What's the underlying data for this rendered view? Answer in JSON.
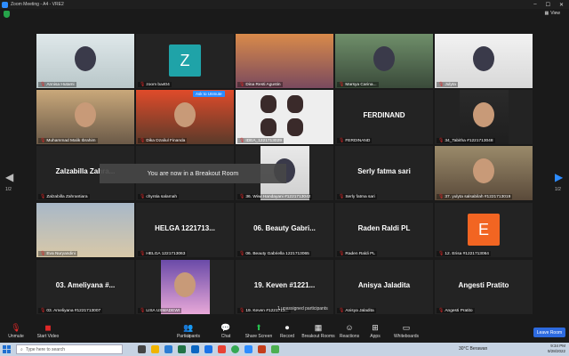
{
  "window": {
    "title": "Zoom Meeting - A4 - VRE2"
  },
  "view_label": "View",
  "nav": {
    "left_page": "1/2",
    "right_page": "1/2"
  },
  "banner": "You are now in a Breakout Room",
  "ask_unmute": "Ask to Unmute",
  "unassigned": "1 unassigned participants",
  "tiles": [
    {
      "caption": "Annisa Hutami",
      "big": ""
    },
    {
      "caption": "zoom ba404",
      "big": "",
      "avatar": "Z"
    },
    {
      "caption": "Dina Resti Agustin",
      "big": ""
    },
    {
      "caption": "Marsya Carina...",
      "big": ""
    },
    {
      "caption": "Julyta",
      "big": ""
    },
    {
      "caption": "Muhammad Malik Ibrahim",
      "big": ""
    },
    {
      "caption": "Dika Dzaliul Finanda",
      "big": ""
    },
    {
      "caption": "IDEA_1221713029",
      "big": ""
    },
    {
      "caption": "FERDINAND",
      "big": "FERDINAND"
    },
    {
      "caption": "34_Tabitha #1221713048",
      "big": ""
    },
    {
      "caption": "Zalzabilla Zahrantiara",
      "big": "Zalzabilla Zahra..."
    },
    {
      "caption": "chyntia salamah",
      "big": ""
    },
    {
      "caption": "36. Wiwi Handayani #1221713042",
      "big": ""
    },
    {
      "caption": "Serly fatma sari",
      "big": "Serly fatma sari"
    },
    {
      "caption": "37. yulyta salsabilah #1221713019",
      "big": ""
    },
    {
      "caption": "Eva Nuryandini",
      "big": ""
    },
    {
      "caption": "HELGA 1221713063",
      "big": "HELGA 1221713..."
    },
    {
      "caption": "06. Beauty Gabriella 1221713065",
      "big": "06. Beauty Gabri..."
    },
    {
      "caption": "Raden Raldi PL",
      "big": "Raden Raldi PL"
    },
    {
      "caption": "12. Erisa #1221713064",
      "big": "",
      "avatar": "E"
    },
    {
      "caption": "03. Ameliyana #1221713007",
      "big": "03. Ameliyana #..."
    },
    {
      "caption": "LISA USMADEWI",
      "big": ""
    },
    {
      "caption": "19. Keven #1221713...",
      "big": "19. Keven #1221..."
    },
    {
      "caption": "Anisya Jaladita",
      "big": "Anisya Jaladita"
    },
    {
      "caption": "Angesti Pratito",
      "big": "Angesti Pratito"
    }
  ],
  "toolbar": {
    "unmute": "Unmute",
    "start_video": "Start Video",
    "participants": "Participants",
    "participants_count": "27",
    "chat": "Chat",
    "share": "Share Screen",
    "record": "Record",
    "breakout": "Breakout Rooms",
    "reactions": "Reactions",
    "apps": "Apps",
    "whiteboards": "Whiteboards",
    "leave": "Leave Room"
  },
  "taskbar": {
    "search_placeholder": "Type here to search",
    "weather": "30°C  Berawan",
    "time": "9:34 PM",
    "date": "9/28/2022"
  },
  "colors": {
    "accent": "#2d8cff",
    "highlight": "#c9d63a",
    "muted_mic": "#e02828",
    "zoom_tile": "#1fa3a8",
    "erisa_tile": "#f26522"
  }
}
